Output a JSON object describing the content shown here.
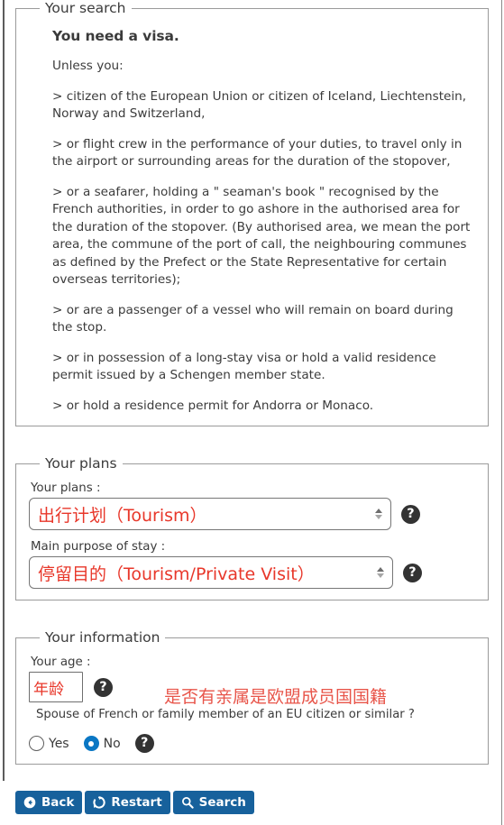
{
  "search": {
    "legend": "Your search",
    "result_title": "You need a visa.",
    "intro": "Unless you:",
    "exceptions": [
      "> citizen of the European Union or citizen of Iceland, Liechtenstein, Norway and Switzerland,",
      "> or flight crew in the performance of your duties, to travel only in the airport or surrounding areas for the duration of the stopover,",
      "> or a seafarer, holding a \" seaman's book \" recognised by the French authorities, in order to go ashore in the authorised area for the duration of the stopover. (By authorised area, we mean the port area, the commune of the port of call, the neighbouring communes as defined by the Prefect or the State Representative for certain overseas territories);",
      "> or are a passenger of a vessel who will remain on board during the stop.",
      "> or in possession of a long-stay visa or hold a valid residence permit issued by a Schengen member state.",
      "> or hold a residence permit for Andorra or Monaco."
    ]
  },
  "plans": {
    "legend": "Your plans",
    "plans_label": "Your plans :",
    "plans_value": "出行计划（Tourism）",
    "purpose_label": "Main purpose of stay :",
    "purpose_value": "停留目的（Tourism/Private Visit）",
    "help_glyph": "?"
  },
  "information": {
    "legend": "Your information",
    "age_label": "Your age :",
    "age_value": "年龄",
    "age_placeholder": "",
    "annotation_cn": "是否有亲属是欧盟成员国国籍",
    "question": "Spouse of French or family member of an EU citizen or similar ?",
    "options": [
      {
        "label": "Yes",
        "checked": false
      },
      {
        "label": "No",
        "checked": true
      }
    ],
    "help_glyph": "?"
  },
  "actions": {
    "back": "Back",
    "restart": "Restart",
    "search": "Search"
  },
  "colors": {
    "accent_blue": "#17619c",
    "radio_blue": "#0a77c4",
    "annotation_red": "#e8554a",
    "value_red": "#e8372a",
    "text": "#3b3b3b",
    "border": "#9b9b9b"
  }
}
